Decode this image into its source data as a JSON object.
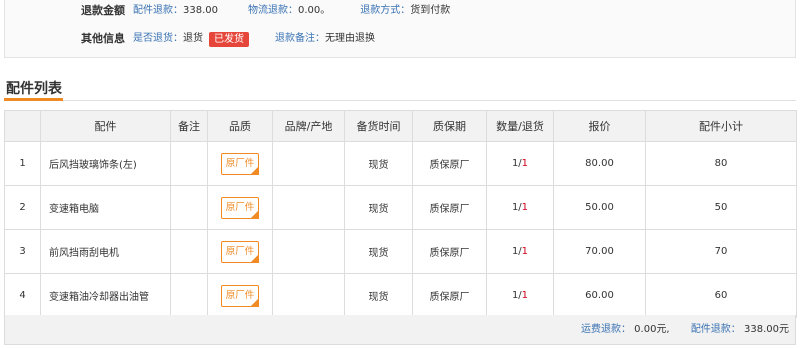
{
  "refund": {
    "label": "退款金额",
    "parts_refund_label": "配件退款：",
    "parts_refund_value": "338.00",
    "logistics_refund_label": "物流退款：",
    "logistics_refund_value": "0.00。",
    "refund_method_label": "退款方式：",
    "refund_method_value": "货到付款"
  },
  "other": {
    "label": "其他信息",
    "is_returned_label": "是否退货：",
    "is_returned_value": "退货",
    "shipped_badge": "已发货",
    "refund_note_label": "退款备注：",
    "refund_note_value": "无理由退换"
  },
  "section": {
    "title": "配件列表",
    "accent_color": "#f08a24"
  },
  "table": {
    "headers": [
      "",
      "配件",
      "备注",
      "品质",
      "品牌/产地",
      "备货时间",
      "质保期",
      "数量/退货",
      "报价",
      "配件小计"
    ],
    "rows": [
      {
        "idx": "1",
        "name": "后风挡玻璃饰条(左)",
        "note": "",
        "quality": "原厂件",
        "brand": "",
        "stock": "现货",
        "warranty": "质保原厂",
        "qty": "1/",
        "ret": "1",
        "price": "80.00",
        "subtotal": "80"
      },
      {
        "idx": "2",
        "name": "变速箱电脑",
        "note": "",
        "quality": "原厂件",
        "brand": "",
        "stock": "现货",
        "warranty": "质保原厂",
        "qty": "1/",
        "ret": "1",
        "price": "50.00",
        "subtotal": "50"
      },
      {
        "idx": "3",
        "name": "前风挡雨刮电机",
        "note": "",
        "quality": "原厂件",
        "brand": "",
        "stock": "现货",
        "warranty": "质保原厂",
        "qty": "1/",
        "ret": "1",
        "price": "70.00",
        "subtotal": "70"
      },
      {
        "idx": "4",
        "name": "变速箱油冷却器出油管",
        "note": "",
        "quality": "原厂件",
        "brand": "",
        "stock": "现货",
        "warranty": "质保原厂",
        "qty": "1/",
        "ret": "1",
        "price": "60.00",
        "subtotal": "60"
      }
    ]
  },
  "footer": {
    "shipping_refund_label": "运费退款：",
    "shipping_refund_value": "0.00元,",
    "parts_refund_label": "配件退款：",
    "parts_refund_value": "338.00元"
  }
}
